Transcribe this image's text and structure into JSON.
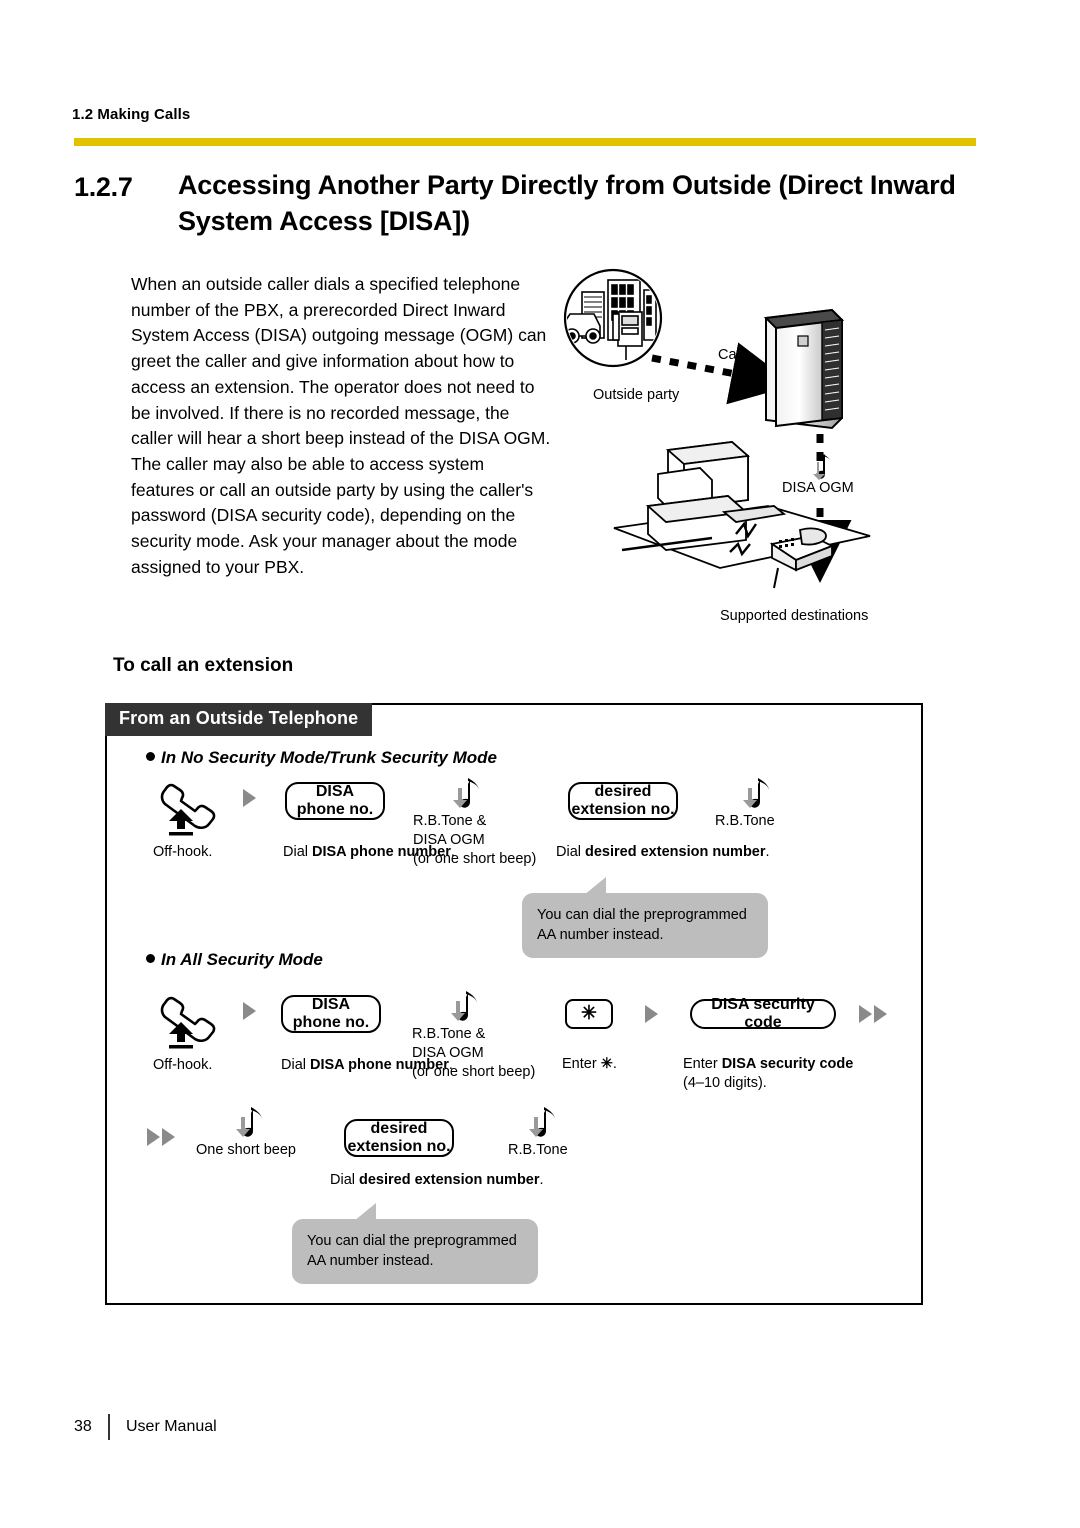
{
  "header": {
    "running_head": "1.2 Making Calls",
    "rule_color": "#E0C200",
    "section_number": "1.2.7",
    "section_title": "Accessing Another Party Directly from Outside (Direct Inward System Access [DISA])"
  },
  "intro": {
    "paragraph_1": "When an outside caller dials a specified telephone number of the PBX, a prerecorded Direct Inward System Access (DISA) outgoing message (OGM) can greet the caller and give information about how to access an extension. The operator does not need to be involved. If there is no recorded message, the caller will hear a short beep instead of the DISA OGM.",
    "paragraph_2": "The caller may also be able to access system features or call an outside party by using the caller's password (DISA security code), depending on the security mode. Ask your manager about the mode assigned to your PBX."
  },
  "illustration": {
    "outside_party": "Outside party",
    "call": "Call",
    "disa_ogm": "DISA OGM",
    "supported_destinations": "Supported destinations"
  },
  "procedure": {
    "sub_heading": "To call an extension",
    "tab_label": "From an Outside Telephone",
    "section_a": {
      "heading": "In No Security Mode/Trunk Security Mode",
      "steps": [
        {
          "icon": "off-hook-handset-icon",
          "caption": "Off-hook."
        },
        {
          "key_line1": "DISA",
          "key_line2": "phone no.",
          "caption_plain": "Dial ",
          "caption_bold": "DISA phone number",
          "caption_tail": "."
        },
        {
          "icon": "tone-note-icon",
          "caption_line1": "R.B.Tone &",
          "caption_line2": "DISA OGM",
          "caption_line3": "(or one short beep)"
        },
        {
          "key_line1": "desired",
          "key_line2": "extension no.",
          "caption_plain": "Dial ",
          "caption_bold": "desired extension number",
          "caption_tail": "."
        },
        {
          "icon": "tone-note-icon",
          "caption_line1": "R.B.Tone"
        }
      ],
      "bubble": "You can dial the preprogrammed AA number instead."
    },
    "section_b": {
      "heading": "In All Security Mode",
      "steps_row1": [
        {
          "icon": "off-hook-handset-icon",
          "caption": "Off-hook."
        },
        {
          "key_line1": "DISA",
          "key_line2": "phone no.",
          "caption_plain": "Dial ",
          "caption_bold": "DISA phone number",
          "caption_tail": "."
        },
        {
          "icon": "tone-note-icon",
          "caption_line1": "R.B.Tone &",
          "caption_line2": "DISA OGM",
          "caption_line3": "(or one short beep)"
        },
        {
          "key_line1": "✳",
          "caption_plain": "Enter ",
          "caption_bold": "✳",
          "caption_tail": "."
        },
        {
          "key_line1": "DISA security code",
          "caption_plain": "Enter ",
          "caption_bold": "DISA security code",
          "caption_line2": "(4–10 digits)."
        }
      ],
      "steps_row2": [
        {
          "icon": "tone-note-icon",
          "caption_line1": "One short beep"
        },
        {
          "key_line1": "desired",
          "key_line2": "extension no.",
          "caption_plain": "Dial ",
          "caption_bold": "desired extension number",
          "caption_tail": "."
        },
        {
          "icon": "tone-note-icon",
          "caption_line1": "R.B.Tone"
        }
      ],
      "bubble": "You can dial the preprogrammed AA number instead."
    }
  },
  "footer": {
    "page_number": "38",
    "label": "User Manual"
  }
}
